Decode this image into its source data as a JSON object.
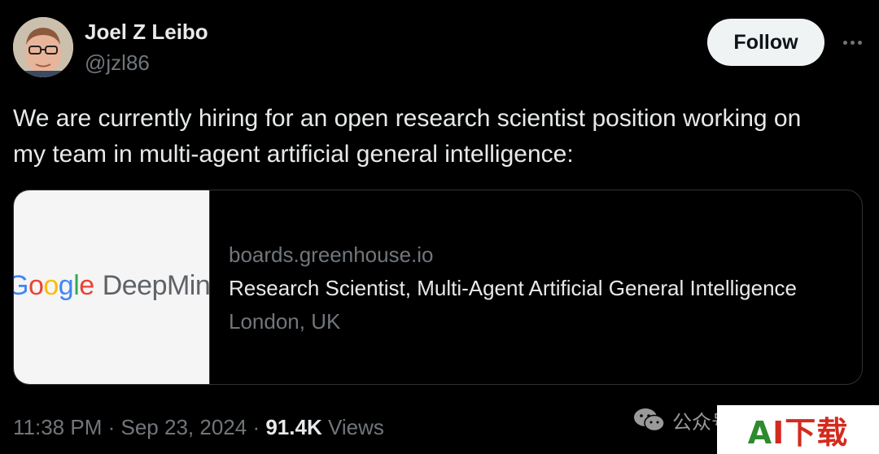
{
  "author": {
    "name": "Joel Z Leibo",
    "handle": "@jzl86",
    "avatar_icon": "user-avatar-photo"
  },
  "actions": {
    "follow_label": "Follow",
    "more_icon": "more-horizontal-icon"
  },
  "tweet": {
    "text": "We are currently hiring for an open research scientist position working on\nmy team in multi-agent artificial general intelligence:"
  },
  "card": {
    "thumbnail_brand": {
      "google": "Google",
      "rest": "DeepMind",
      "google_colors": [
        "#4285F4",
        "#EA4335",
        "#FBBC05",
        "#4285F4",
        "#34A853",
        "#EA4335"
      ],
      "rest_color": "#5f6368"
    },
    "domain": "boards.greenhouse.io",
    "title": "Research Scientist, Multi-Agent Artificial General Intelligence",
    "location": "London, UK"
  },
  "meta": {
    "time": "11:38 PM",
    "separator": "·",
    "date": "Sep 23, 2024",
    "views_count": "91.4K",
    "views_label": "Views"
  },
  "overlay": {
    "wechat_icon": "wechat-icon",
    "wechat_text": "公众号",
    "watermark_text": "AI下载",
    "watermark_colors": [
      "#2e8b2e",
      "#d42a1e"
    ]
  }
}
